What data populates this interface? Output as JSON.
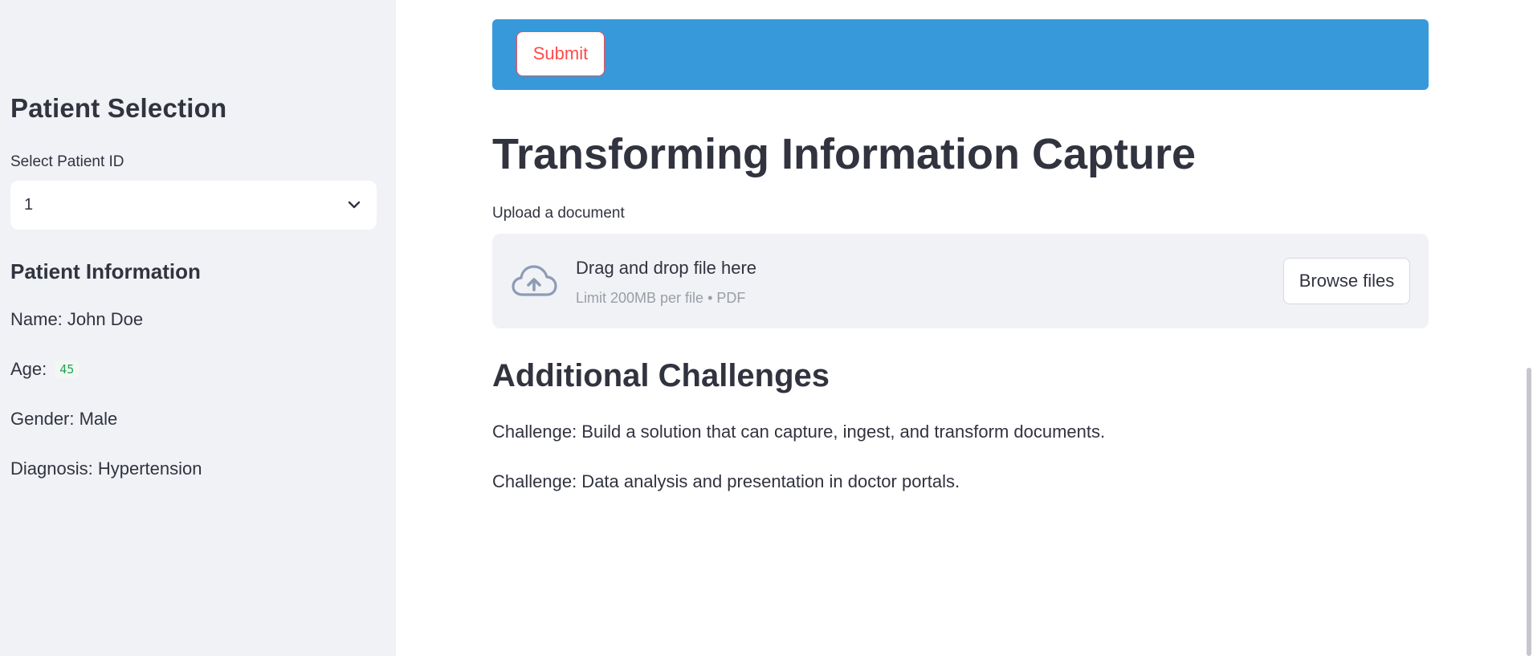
{
  "sidebar": {
    "title": "Patient Selection",
    "select_label": "Select Patient ID",
    "select_value": "1",
    "info_title": "Patient Information",
    "name_line": "Name: John Doe",
    "age_label": "Age:",
    "age_value": "45",
    "gender_line": "Gender: Male",
    "diagnosis_line": "Diagnosis: Hypertension"
  },
  "banner": {
    "submit_label": "Submit",
    "color": "#3799da",
    "accent": "#ff4b4b"
  },
  "main": {
    "title": "Transforming Information Capture",
    "upload_label": "Upload a document",
    "dropzone": {
      "title": "Drag and drop file here",
      "subtitle": "Limit 200MB per file • PDF",
      "browse_label": "Browse files",
      "icon": "cloud-upload-icon"
    },
    "section_title": "Additional Challenges",
    "challenges": [
      "Challenge: Build a solution that can capture, ingest, and transform documents.",
      "Challenge: Data analysis and presentation in doctor portals."
    ]
  }
}
